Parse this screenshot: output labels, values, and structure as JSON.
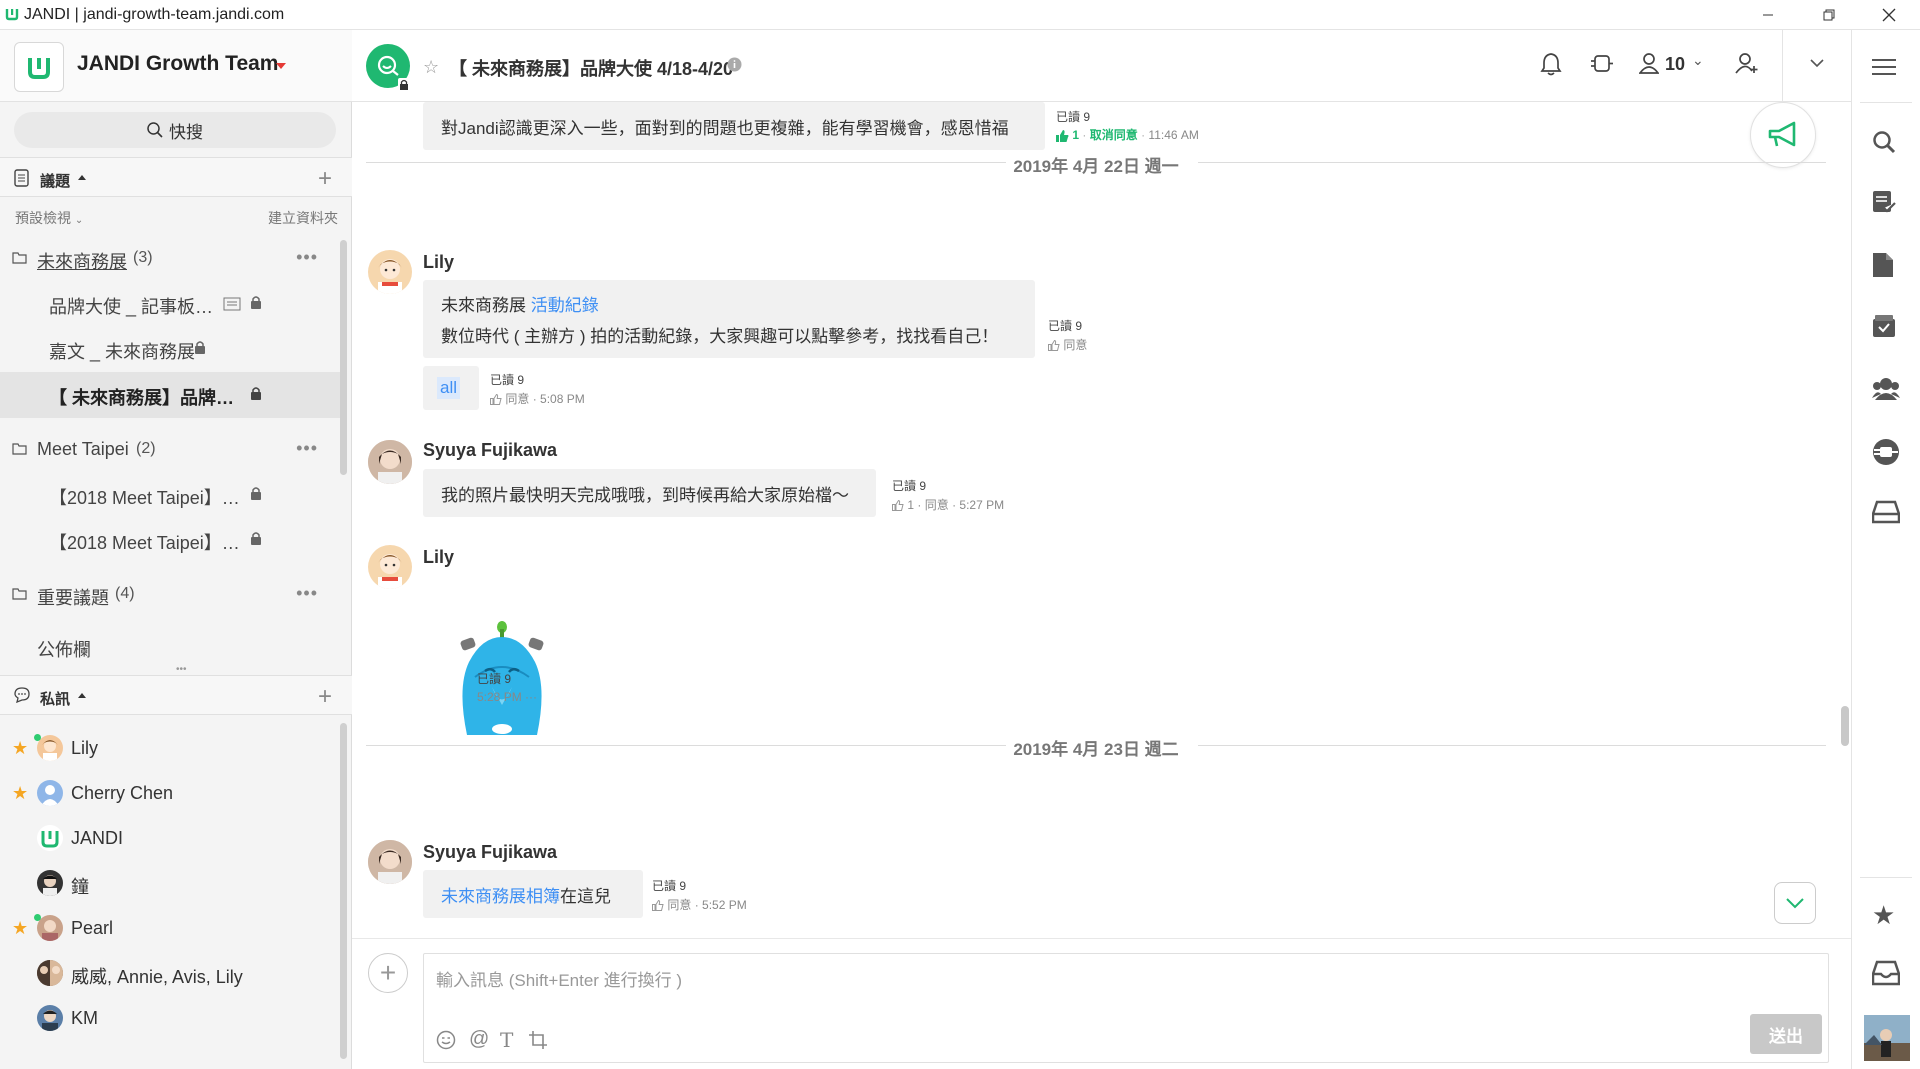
{
  "window": {
    "title": "JANDI | jandi-growth-team.jandi.com"
  },
  "sidebar": {
    "team_name": "JANDI Growth Team",
    "search_label": "快搜",
    "topics_label": "議題",
    "default_view": "預設檢視",
    "create_folder": "建立資料夾",
    "folders": [
      {
        "name": "未來商務展",
        "count": "(3)",
        "items": [
          {
            "label": "品牌大使 _ 記事板…"
          },
          {
            "label": "嘉文 _ 未來商務展"
          },
          {
            "label": "【 未來商務展】品牌…"
          }
        ]
      },
      {
        "name": "Meet Taipei",
        "count": "(2)",
        "items": [
          {
            "label": "【2018 Meet Taipei】…"
          },
          {
            "label": "【2018 Meet Taipei】…"
          }
        ]
      },
      {
        "name": "重要議題",
        "count": "(4)",
        "items": []
      }
    ],
    "bulletin": "公佈欄",
    "dm_label": "私訊",
    "dms": [
      {
        "name": "Lily"
      },
      {
        "name": "Cherry Chen"
      },
      {
        "name": "JANDI"
      },
      {
        "name": "鐘"
      },
      {
        "name": "Pearl"
      },
      {
        "name": "威威, Annie, Avis, Lily"
      },
      {
        "name": "KM"
      }
    ]
  },
  "channel": {
    "title": "【 未來商務展】品牌大使 4/18-4/20",
    "member_count": "10"
  },
  "messages": {
    "m0": {
      "text": "對Jandi認識更深入一些，面對到的問題也更複雜，能有學習機會，感恩惜福",
      "read": "已讀 9",
      "likes": "1",
      "cancel": "取消同意",
      "time": "11:46 AM"
    },
    "date1": "2019年 4月 22日 週一",
    "m1": {
      "sender": "Lily",
      "line1_prefix": "未來商務展 ",
      "line1_link": "活動紀錄",
      "line2": "數位時代 ( 主辦方 ) 拍的活動紀錄，大家興趣可以點擊參考，找找看自己！",
      "read": "已讀 9",
      "agree": "同意"
    },
    "m2": {
      "text": "all",
      "read": "已讀 9",
      "agree": "同意",
      "time": "5:08 PM"
    },
    "m3": {
      "sender": "Syuya Fujikawa",
      "text": "我的照片最快明天完成哦哦，到時候再給大家原始檔～",
      "read": "已讀 9",
      "likes": "1",
      "agree": "同意",
      "time": "5:27 PM"
    },
    "m4": {
      "sender": "Lily",
      "read": "已讀 9",
      "time": "5:28 PM"
    },
    "date2": "2019年 4月 23日 週二",
    "m5": {
      "sender": "Syuya Fujikawa",
      "link": "未來商務展相簿",
      "suffix": " 在這兒",
      "read": "已讀 9",
      "agree": "同意",
      "time": "5:52 PM"
    }
  },
  "input": {
    "placeholder": "輸入訊息 (Shift+Enter 進行換行 )",
    "send": "送出"
  },
  "colors": {
    "brand_green": "#1fb871",
    "link_blue": "#3e8ff4",
    "accent_red": "#e53935"
  }
}
